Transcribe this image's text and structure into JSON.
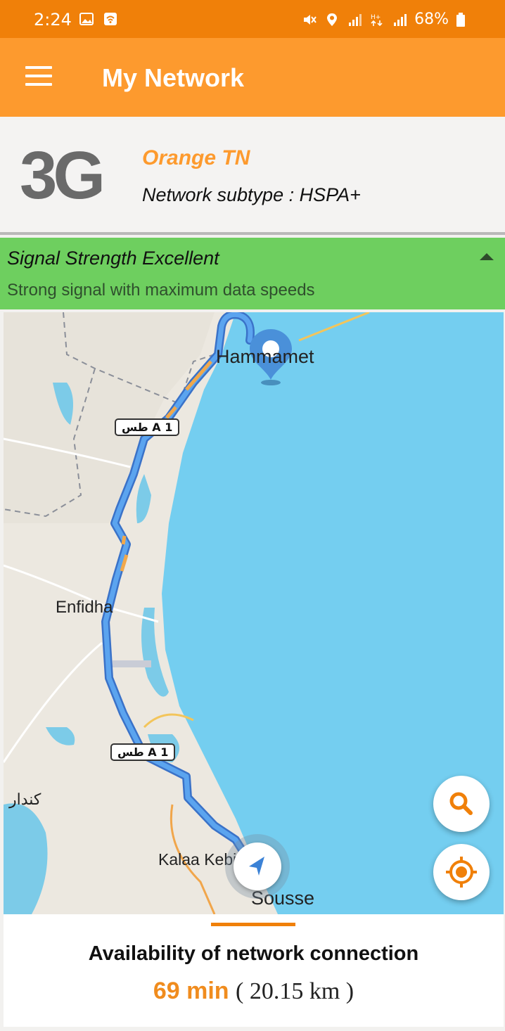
{
  "status_bar": {
    "time": "2:24",
    "battery": "68%",
    "left_icons": [
      "gallery-icon",
      "wifi-calling-icon"
    ],
    "right_icons": [
      "mute-icon",
      "location-icon",
      "signal-icon",
      "data-icon",
      "signal-icon",
      "battery-icon"
    ]
  },
  "app_bar": {
    "title": "My Network",
    "menu_icon": "hamburger-menu-icon"
  },
  "network": {
    "generation": "3G",
    "operator": "Orange TN",
    "subtype": "Network subtype : HSPA+"
  },
  "signal": {
    "heading": "Signal Strength Excellent",
    "description": "Strong signal with maximum data speeds",
    "toggle_icon": "collapse-arrow-icon",
    "bg_color": "#6ecf5f"
  },
  "map": {
    "places": {
      "hammamet": "Hammamet",
      "enfidha": "Enfidha",
      "kondar": "كندار",
      "kalaa": "Kalaa Kebira",
      "sousse": "Sousse"
    },
    "road_shields": [
      "طس A 1",
      "طس A 1"
    ],
    "sea_color": "#74cef0",
    "route_color": "#4a8fe6",
    "buttons": {
      "search_icon": "search-icon",
      "locate_icon": "my-location-icon",
      "navigation_icon": "navigation-arrow-icon"
    }
  },
  "availability": {
    "label": "Availability of network connection",
    "duration": "69 min",
    "distance": "( 20.15 km )",
    "accent_color": "#f08c1e"
  }
}
